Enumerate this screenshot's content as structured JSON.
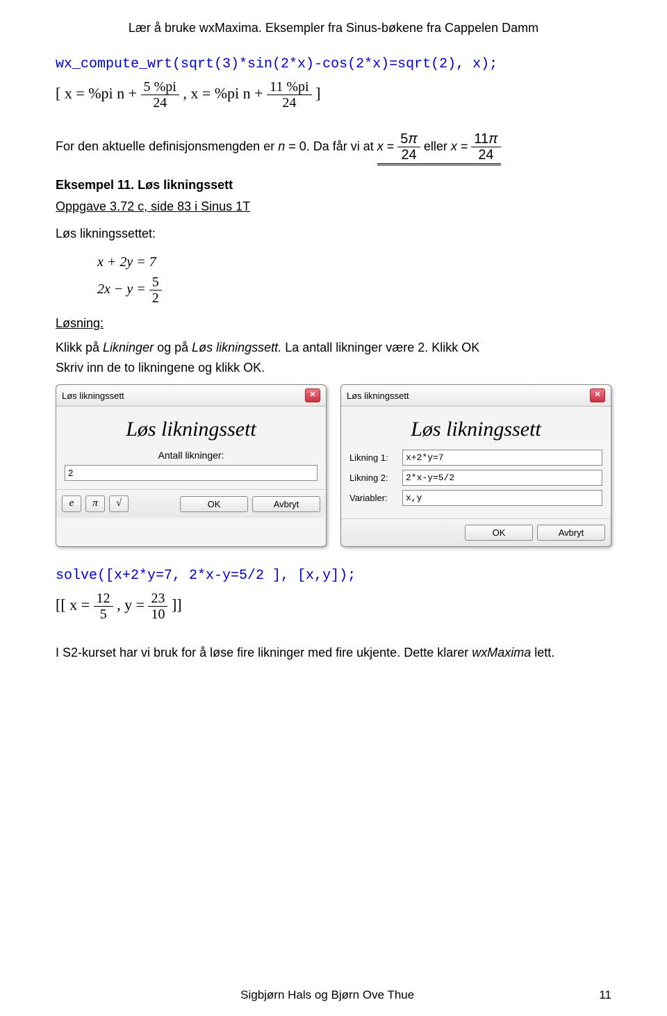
{
  "header": "Lær å bruke wxMaxima. Eksempler fra Sinus-bøkene fra Cappelen Damm",
  "code1": "wx_compute_wrt(sqrt(3)*sin(2*x)-cos(2*x)=sqrt(2), x);",
  "out1_left": "[ x = %pi n +",
  "out1_f1_num": "5 %pi",
  "out1_f1_den": "24",
  "out1_mid": " , x = %pi n +",
  "out1_f2_num": "11 %pi",
  "out1_f2_den": "24",
  "out1_right": " ]",
  "p1a": "For den aktuelle definisjonsmengden er ",
  "p1n": "n",
  "p1b": " = 0. Da får vi at ",
  "p1x1": "x",
  "p1eq": " = ",
  "f5": "5",
  "pi": "π",
  "d24": "24",
  "eller": " eller ",
  "p1x2": "x",
  "f11": "11",
  "section": "Eksempel 11. Løs likningssett",
  "task": "Oppgave 3.72 c, side 83 i Sinus 1T",
  "prompt": "Løs likningssettet:",
  "eq1": "x + 2y = 7",
  "eq2a": "2x − y = ",
  "eq2num": "5",
  "eq2den": "2",
  "losning": "Løsning:",
  "instr1a": "Klikk på ",
  "instr1b": "Likninger",
  "instr1c": " og på ",
  "instr1d": "Løs likningssett.",
  "instr1e": " La antall likninger være 2. Klikk OK",
  "instr2": "Skriv inn de to likningene og klikk OK.",
  "dlg1": {
    "title": "Løs likningssett",
    "big": "Løs likningssett",
    "label": "Antall likninger:",
    "value": "2",
    "ok": "OK",
    "cancel": "Avbryt"
  },
  "dlg2": {
    "title": "Løs likningssett",
    "big": "Løs likningssett",
    "l1": "Likning 1:",
    "v1": "x+2*y=7",
    "l2": "Likning 2:",
    "v2": "2*x-y=5/2",
    "l3": "Variabler:",
    "v3": "x,y",
    "ok": "OK",
    "cancel": "Avbryt"
  },
  "code2": "solve([x+2*y=7, 2*x-y=5/2   ], [x,y]);",
  "out2_open": "[[ x =",
  "out2_n1": "12",
  "out2_d1": "5",
  "out2_mid": ", y =",
  "out2_n2": "23",
  "out2_d2": "10",
  "out2_close": "]]",
  "closing_a": "I S2-kurset har vi bruk for å løse fire likninger med fire ukjente. Dette klarer ",
  "closing_b": "wxMaxima",
  "closing_c": " lett.",
  "footer_left": "Sigbjørn Hals og Bjørn Ove Thue",
  "footer_right": "11",
  "sym_e": "e",
  "sym_pi": "π",
  "sym_sqrt": "√"
}
